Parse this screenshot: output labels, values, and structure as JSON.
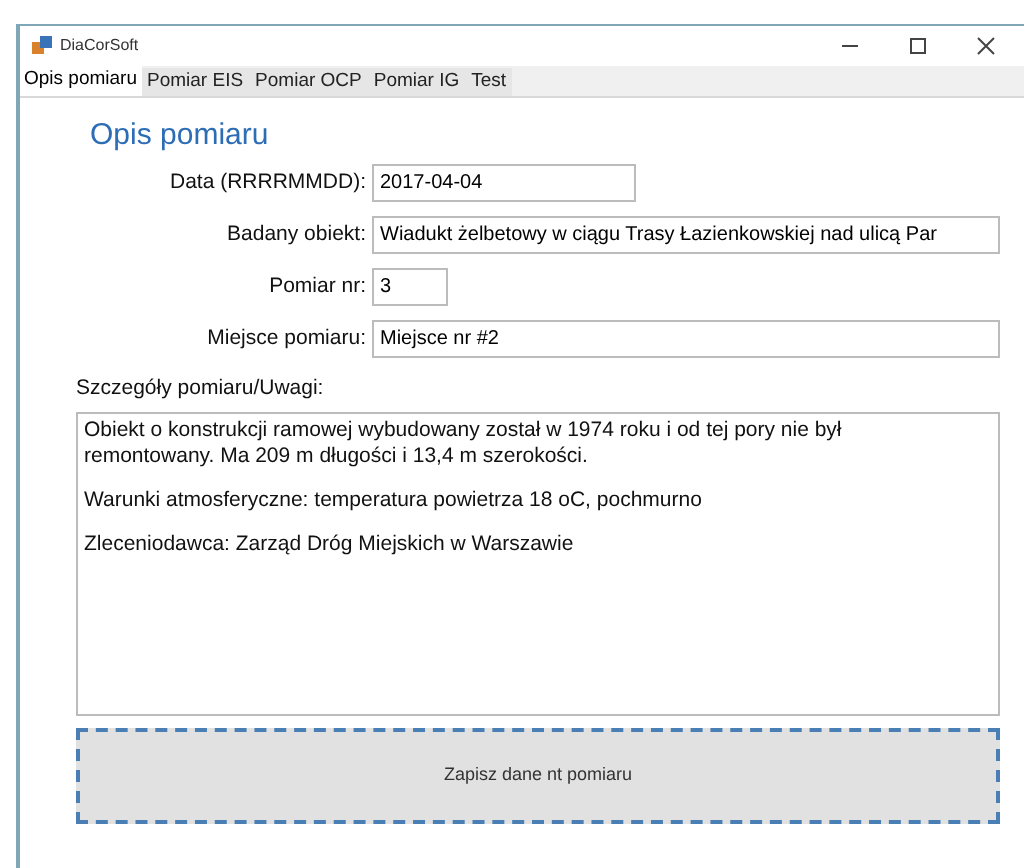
{
  "window": {
    "title": "DiaCorSoft"
  },
  "tabs": [
    {
      "label": "Opis pomiaru",
      "selected": true
    },
    {
      "label": "Pomiar EIS",
      "selected": false
    },
    {
      "label": "Pomiar OCP",
      "selected": false
    },
    {
      "label": "Pomiar IG",
      "selected": false
    },
    {
      "label": "Test",
      "selected": false
    }
  ],
  "heading": "Opis pomiaru",
  "fields": [
    {
      "label": "Data (RRRRMMDD):",
      "value": "2017-04-04"
    },
    {
      "label": "Badany obiekt:",
      "value": "Wiadukt żelbetowy w ciągu Trasy Łazienkowskiej nad ulicą Par"
    },
    {
      "label": "Pomiar nr:",
      "value": "3"
    },
    {
      "label": "Miejsce pomiaru:",
      "value": "Miejsce nr #2"
    }
  ],
  "notes": {
    "label": "Szczegóły pomiaru/Uwagi:",
    "paragraphs": [
      "Obiekt o konstrukcji ramowej wybudowany został w 1974 roku i od tej pory nie był remontowany. Ma 209 m długości i 13,4 m szerokości.",
      "Warunki atmosferyczne: temperatura powietrza 18 oC, pochmurno",
      "Zleceniodawca: Zarząd Dróg Miejskich w Warszawie"
    ]
  },
  "save_button": "Zapisz dane nt pomiaru"
}
